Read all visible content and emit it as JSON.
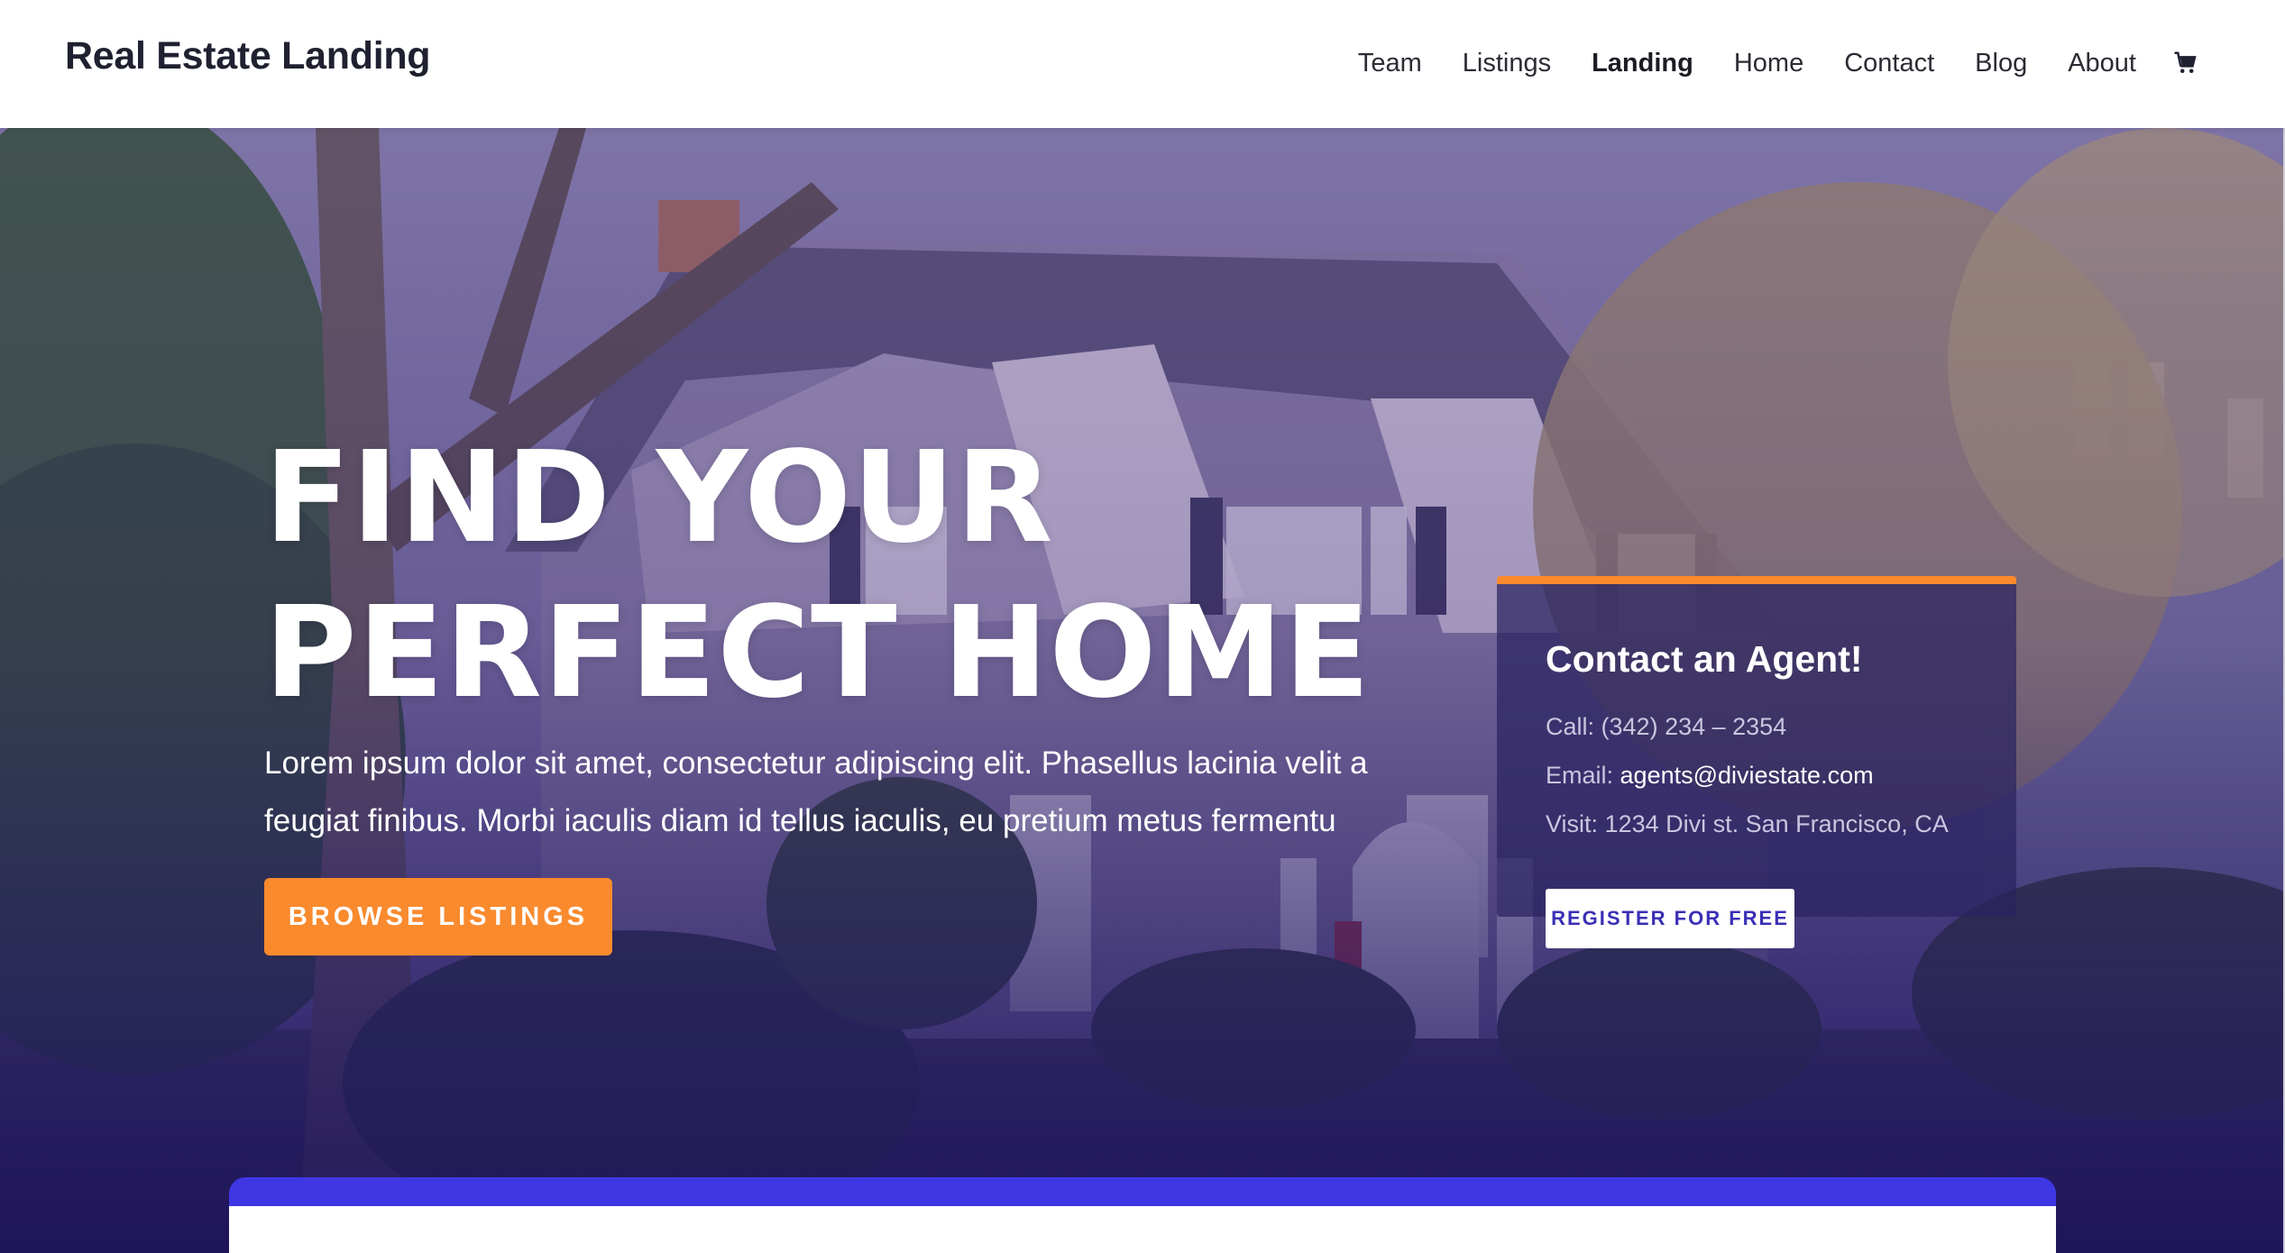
{
  "header": {
    "logo": "Real Estate Landing",
    "nav": [
      "Team",
      "Listings",
      "Landing",
      "Home",
      "Contact",
      "Blog",
      "About"
    ],
    "active_nav": "Landing",
    "cart_icon": "cart-icon"
  },
  "hero": {
    "title_line1": "FIND YOUR",
    "title_line2": "PERFECT HOME",
    "text": "Lorem ipsum dolor sit amet, consectetur adipiscing elit. Phasellus lacinia velit a feugiat finibus. Morbi iaculis diam id tellus iaculis, eu pretium metus fermentu",
    "button": "BROWSE LISTINGS"
  },
  "contact_card": {
    "title": "Contact an Agent!",
    "call_label": "Call:",
    "call_value": "(342) 234 – 2354",
    "email_label": "Email:",
    "email_value": "agents@diviestate.com",
    "visit_label": "Visit:",
    "visit_value": "1234 Divi st. San Francisco, CA",
    "button": "REGISTER FOR FREE"
  },
  "colors": {
    "accent_orange": "#f98a2e",
    "accent_blue": "#3f37e3",
    "overlay_purple": "#2a2260"
  }
}
